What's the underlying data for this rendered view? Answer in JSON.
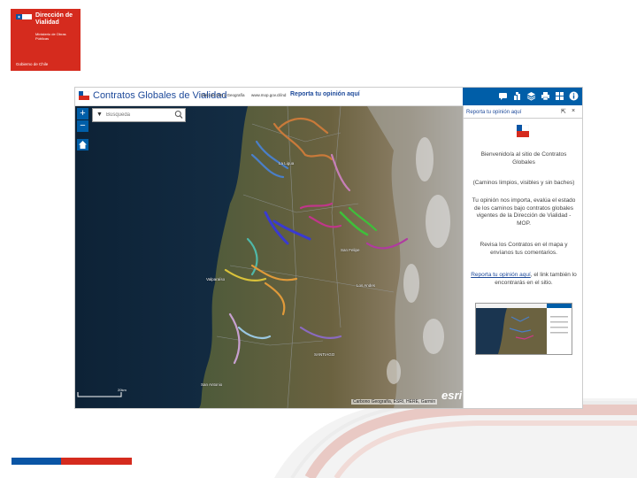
{
  "logo": {
    "org": "Dirección de Vialidad",
    "ministry": "Ministerio de Obras Públicas",
    "gov": "Gobierno de Chile"
  },
  "app": {
    "title": "Contratos Globales de Vialidad",
    "links": [
      "Ídolo de IDE y Geografía",
      "www.mop.gov.cl/ind",
      "Reporta tu opinión aquí"
    ],
    "toolbar_icons": [
      "comment-icon",
      "layers-stack-icon",
      "layers-icon",
      "print-icon",
      "grid-icon",
      "info-icon"
    ]
  },
  "map": {
    "search_placeholder": "Búsqueda",
    "zoom_in": "+",
    "zoom_out": "−",
    "places": [
      "Valparaíso",
      "San Antonio",
      "SANTIAGO",
      "Los Andes",
      "San Felipe",
      "La Ligua"
    ],
    "scale_label": "20km",
    "attribution": "Carbono Geografía, ESRI, HERE, Garmin",
    "esri": "esri"
  },
  "panel": {
    "title": "Reporta tu opinión aquí",
    "minimize": "⇱",
    "close": "×",
    "p1": "Bienvenido/a al sitio de Contratos Globales",
    "p2": "(Caminos limpios, visibles y sin baches)",
    "p3": "Tu opinión nos importa, evalúa el estado de los caminos bajo contratos globales vigentes de la Dirección de Vialidad - MOP.",
    "p4": "Revisa los Contratos en el mapa y envíanos tus comentarios.",
    "link_text": "Reporta tu opinión aquí",
    "link_rest": ", el link también lo encontrarás en el sitio."
  },
  "colors": {
    "chile_red": "#d52b1e",
    "chile_blue": "#0a55a5",
    "toolbar_blue": "#005ea8",
    "title_blue": "#1e4a9a"
  }
}
